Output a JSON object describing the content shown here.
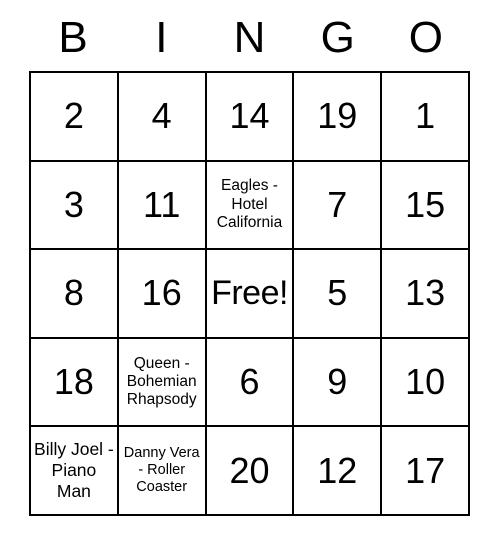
{
  "card": {
    "type": "bingo-card",
    "headers": [
      "B",
      "I",
      "N",
      "G",
      "O"
    ],
    "colors": {
      "background": "#ffffff",
      "grid_line": "#000000",
      "text": "#000000"
    },
    "rows": [
      [
        {
          "value": "2",
          "kind": "number"
        },
        {
          "value": "4",
          "kind": "number"
        },
        {
          "value": "14",
          "kind": "number"
        },
        {
          "value": "19",
          "kind": "number"
        },
        {
          "value": "1",
          "kind": "number"
        }
      ],
      [
        {
          "value": "3",
          "kind": "number"
        },
        {
          "value": "11",
          "kind": "number"
        },
        {
          "value": "Eagles - Hotel California",
          "kind": "text-sm"
        },
        {
          "value": "7",
          "kind": "number"
        },
        {
          "value": "15",
          "kind": "number"
        }
      ],
      [
        {
          "value": "8",
          "kind": "number"
        },
        {
          "value": "16",
          "kind": "number"
        },
        {
          "value": "Free!",
          "kind": "free"
        },
        {
          "value": "5",
          "kind": "number"
        },
        {
          "value": "13",
          "kind": "number"
        }
      ],
      [
        {
          "value": "18",
          "kind": "number"
        },
        {
          "value": "Queen - Bohemian Rhapsody",
          "kind": "text-sm"
        },
        {
          "value": "6",
          "kind": "number"
        },
        {
          "value": "9",
          "kind": "number"
        },
        {
          "value": "10",
          "kind": "number"
        }
      ],
      [
        {
          "value": "Billy Joel - Piano Man",
          "kind": "text-md"
        },
        {
          "value": "Danny Vera - Roller Coaster",
          "kind": "text-xs"
        },
        {
          "value": "20",
          "kind": "number"
        },
        {
          "value": "12",
          "kind": "number"
        },
        {
          "value": "17",
          "kind": "number"
        }
      ]
    ]
  }
}
